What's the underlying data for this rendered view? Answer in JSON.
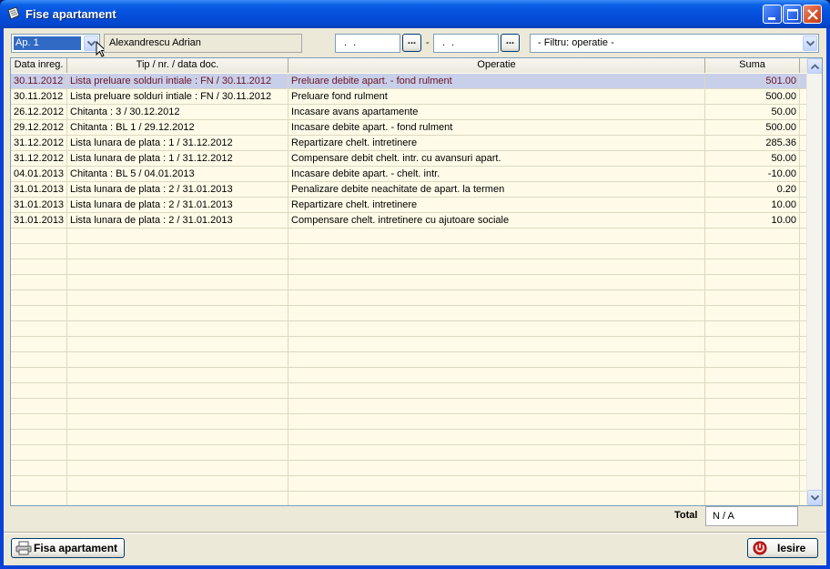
{
  "window": {
    "title": "Fise apartament"
  },
  "toolbar": {
    "apartment": "Ap. 1",
    "owner": "Alexandrescu Adrian",
    "date_from": ". .",
    "date_to": ". .",
    "pick_label": "...",
    "date_separator": "-",
    "filter": "- Filtru: operatie -"
  },
  "table": {
    "columns": [
      "Data inreg.",
      "Tip / nr. / data doc.",
      "Operatie",
      "Suma"
    ],
    "rows": [
      {
        "date": "30.11.2012",
        "doc": "Lista preluare solduri intiale : FN / 30.11.2012",
        "op": "Preluare debite apart. - fond rulment",
        "sum": "501.00"
      },
      {
        "date": "30.11.2012",
        "doc": "Lista preluare solduri intiale : FN / 30.11.2012",
        "op": "Preluare fond rulment",
        "sum": "500.00"
      },
      {
        "date": "26.12.2012",
        "doc": "Chitanta : 3 / 30.12.2012",
        "op": "Incasare avans apartamente",
        "sum": "50.00"
      },
      {
        "date": "29.12.2012",
        "doc": "Chitanta : BL 1 / 29.12.2012",
        "op": "Incasare debite apart. - fond rulment",
        "sum": "500.00"
      },
      {
        "date": "31.12.2012",
        "doc": "Lista lunara de plata : 1 / 31.12.2012",
        "op": "Repartizare chelt. intretinere",
        "sum": "285.36"
      },
      {
        "date": "31.12.2012",
        "doc": "Lista lunara de plata : 1 / 31.12.2012",
        "op": "Compensare debit chelt. intr. cu avansuri apart.",
        "sum": "50.00"
      },
      {
        "date": "04.01.2013",
        "doc": "Chitanta : BL 5 / 04.01.2013",
        "op": "Incasare debite apart. - chelt. intr.",
        "sum": "-10.00"
      },
      {
        "date": "31.01.2013",
        "doc": "Lista lunara de plata : 2 / 31.01.2013",
        "op": "Penalizare debite neachitate de apart. la termen",
        "sum": "0.20"
      },
      {
        "date": "31.01.2013",
        "doc": "Lista lunara de plata : 2 / 31.01.2013",
        "op": "Repartizare chelt. intretinere",
        "sum": "10.00"
      },
      {
        "date": "31.01.2013",
        "doc": "Lista lunara de plata : 2 / 31.01.2013",
        "op": "Compensare chelt. intretinere cu ajutoare sociale",
        "sum": "10.00"
      }
    ]
  },
  "footer": {
    "total_label": "Total",
    "total_value": "N / A",
    "print_button": "Fisa apartament",
    "exit_button": "Iesire"
  },
  "colors": {
    "titlebar": "#0550dd",
    "selected_row_bg": "#c8cfe9",
    "selected_row_text": "#6a1426",
    "grid_bg": "#fffbe8"
  },
  "icons": {
    "title": "notepad-icon",
    "print": "printer-icon",
    "exit": "power-icon"
  }
}
